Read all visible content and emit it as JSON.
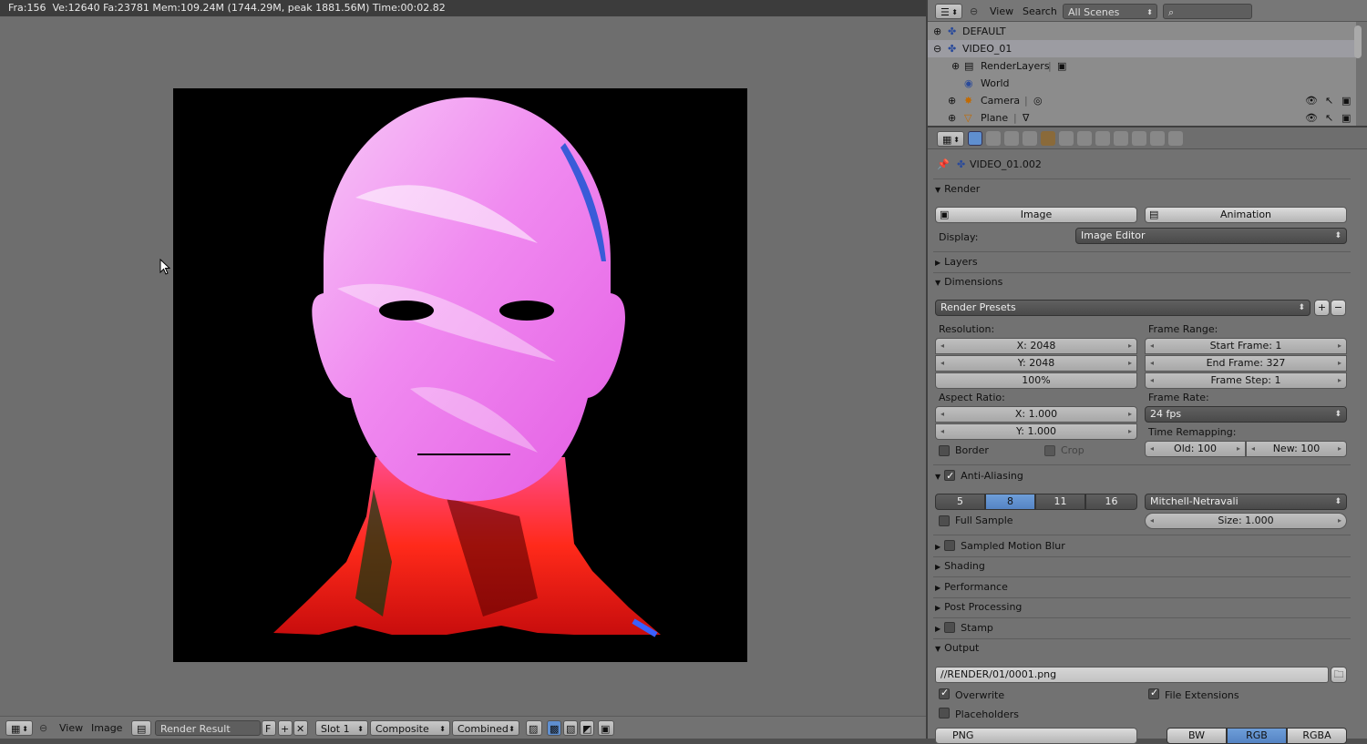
{
  "top_info": "Fra:156  Ve:12640 Fa:23781 Mem:109.24M (1744.29M, peak 1881.56M) Time:00:02.82",
  "image_editor": {
    "menu_view": "View",
    "menu_image": "Image",
    "image_name": "Render Result",
    "fake_user": "F",
    "slot": "Slot 1",
    "composite": "Composite",
    "pass": "Combined"
  },
  "outliner": {
    "menu_view": "View",
    "menu_search": "Search",
    "scene_filter": "All Scenes",
    "rows": [
      {
        "label": "DEFAULT"
      },
      {
        "label": "VIDEO_01"
      },
      {
        "label": "RenderLayers"
      },
      {
        "label": "World"
      },
      {
        "label": "Camera"
      },
      {
        "label": "Plane"
      }
    ]
  },
  "properties": {
    "scene_path": "VIDEO_01.002",
    "render": {
      "title": "Render",
      "image_btn": "Image",
      "animation_btn": "Animation",
      "display_label": "Display:",
      "display_value": "Image Editor"
    },
    "layers_title": "Layers",
    "dimensions": {
      "title": "Dimensions",
      "presets": "Render Presets",
      "resolution_label": "Resolution:",
      "res_x": "X: 2048",
      "res_y": "Y: 2048",
      "res_pct": "100%",
      "frame_range_label": "Frame Range:",
      "start_frame": "Start Frame: 1",
      "end_frame": "End Frame: 327",
      "frame_step": "Frame Step: 1",
      "aspect_label": "Aspect Ratio:",
      "aspect_x": "X: 1.000",
      "aspect_y": "Y: 1.000",
      "frame_rate_label": "Frame Rate:",
      "frame_rate": "24 fps",
      "border": "Border",
      "crop": "Crop",
      "time_remap_label": "Time Remapping:",
      "old": "Old: 100",
      "new": "New: 100"
    },
    "anti_aliasing": {
      "title": "Anti-Aliasing",
      "samples": [
        "5",
        "8",
        "11",
        "16"
      ],
      "selected": "8",
      "filter": "Mitchell-Netravali",
      "full_sample": "Full Sample",
      "size": "Size: 1.000"
    },
    "sampled_motion_blur": "Sampled Motion Blur",
    "shading": "Shading",
    "performance": "Performance",
    "post_processing": "Post Processing",
    "stamp": "Stamp",
    "output": {
      "title": "Output",
      "path": "//RENDER/01/0001.png",
      "overwrite": "Overwrite",
      "file_extensions": "File Extensions",
      "placeholders": "Placeholders",
      "format": "PNG",
      "bw": "BW",
      "rgb": "RGB",
      "rgba": "RGBA"
    }
  }
}
